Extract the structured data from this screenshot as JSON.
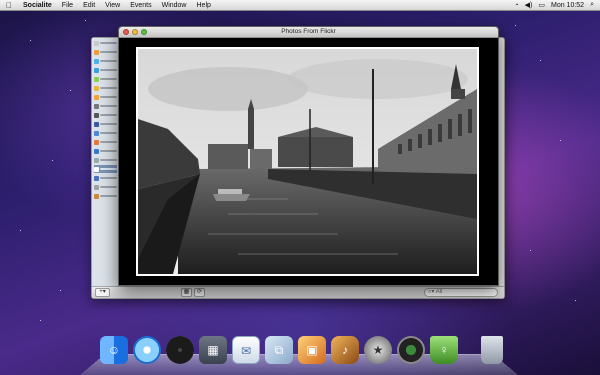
{
  "menubar": {
    "apple_symbol": "",
    "app_name": "Socialite",
    "items": [
      "File",
      "Edit",
      "View",
      "Events",
      "Window",
      "Help"
    ],
    "clock": "Mon 10:52",
    "status_icons": [
      "wifi-icon",
      "volume-icon",
      "battery-icon",
      "spotlight-icon"
    ]
  },
  "photo_window": {
    "title": "Photos From Flickr"
  },
  "socialite_window": {
    "search_placeholder": "All",
    "add_button_label": "+▾"
  },
  "dock": {
    "items": [
      "Finder",
      "Safari",
      "Clock",
      "Dashboard",
      "Mail",
      "Preview",
      "iPhoto",
      "GarageBand",
      "iMovie",
      "Time Machine",
      "Drink App",
      "Trash"
    ]
  },
  "colors": {
    "menubar": "#e8e8e8",
    "desktop_accent": "#4a2a8a",
    "photo_border": "#ffffff"
  }
}
